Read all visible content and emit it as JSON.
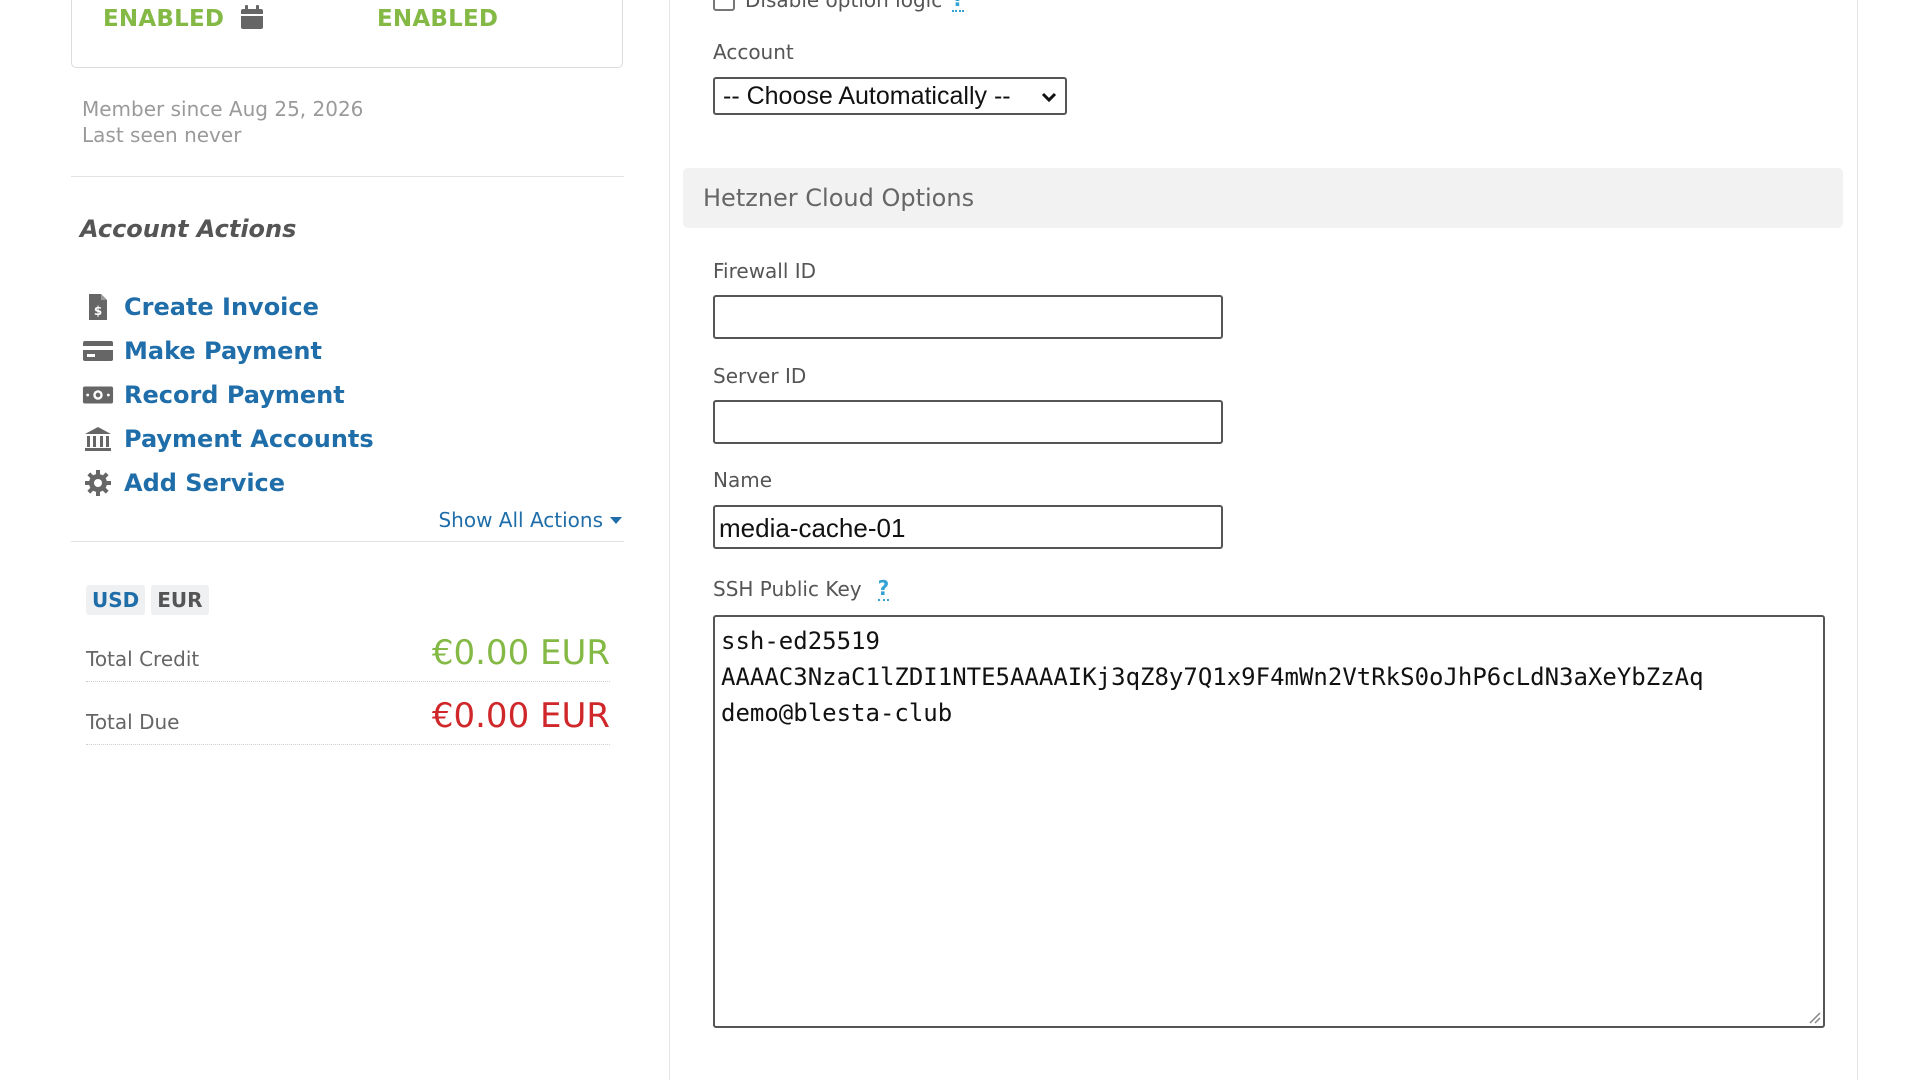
{
  "client_status": {
    "status_1": "ENABLED",
    "status_2": "ENABLED",
    "member_since": "Member since Aug 25, 2026",
    "last_seen": "Last seen never"
  },
  "account_actions": {
    "title": "Account Actions",
    "items": [
      {
        "label": "Create Invoice",
        "icon": "invoice-icon"
      },
      {
        "label": "Make Payment",
        "icon": "credit-card-icon"
      },
      {
        "label": "Record Payment",
        "icon": "money-icon"
      },
      {
        "label": "Payment Accounts",
        "icon": "bank-icon"
      },
      {
        "label": "Add Service",
        "icon": "gear-icon"
      }
    ],
    "show_all": "Show All Actions"
  },
  "currency": {
    "tabs": [
      "USD",
      "EUR"
    ],
    "active": "USD",
    "total_credit_label": "Total Credit",
    "total_credit_value": "€0.00 EUR",
    "total_due_label": "Total Due",
    "total_due_value": "€0.00 EUR"
  },
  "options": {
    "disable_logic_label": "Disable option logic",
    "help": "?",
    "account_label": "Account",
    "account_value": "-- Choose Automatically --"
  },
  "hetzner": {
    "header": "Hetzner Cloud Options",
    "firewall_label": "Firewall ID",
    "firewall_value": "",
    "server_label": "Server ID",
    "server_value": "",
    "name_label": "Name",
    "name_value": "media-cache-01",
    "ssh_label": "SSH Public Key",
    "ssh_help": "?",
    "ssh_line1": "ssh-ed25519",
    "ssh_line2": "AAAAC3NzaC1lZDI1NTE5AAAAIKj3qZ8y7Q1x9F4mWn2VtRkS0oJhP6cLdN3aXeYbZzAq",
    "ssh_line3": "demo@blesta-club"
  },
  "colors": {
    "enabled_green": "#83b944",
    "link_blue": "#1f6ea9",
    "due_red": "#d0272b",
    "help_blue": "#33a2d4"
  }
}
